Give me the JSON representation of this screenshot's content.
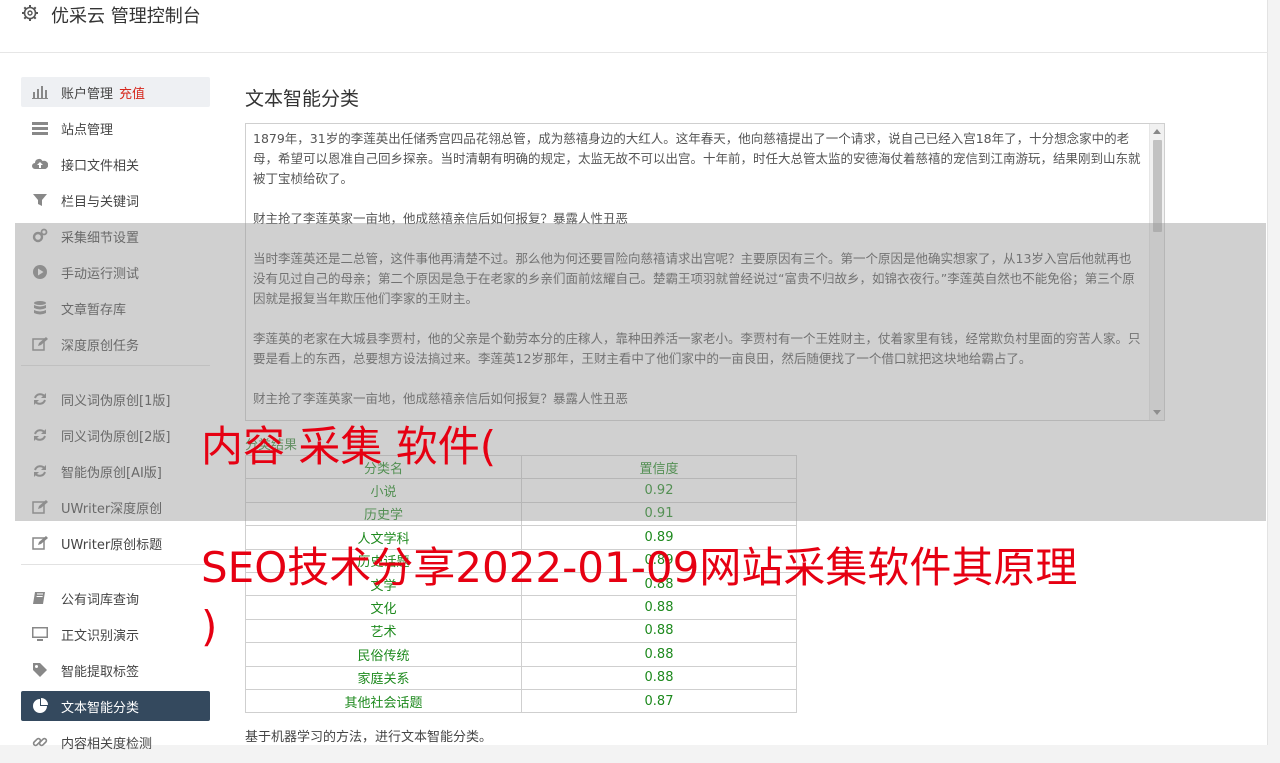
{
  "header": {
    "title": "优采云 管理控制台",
    "icon": "gear-icon"
  },
  "sidebar": {
    "items": [
      {
        "label": "账户管理",
        "badge": "充值",
        "icon": "bar-chart-icon"
      },
      {
        "label": "站点管理",
        "icon": "server-icon"
      },
      {
        "label": "接口文件相关",
        "icon": "cloud-upload-icon"
      },
      {
        "label": "栏目与关键词",
        "icon": "filter-icon"
      },
      {
        "label": "采集细节设置",
        "icon": "gears-icon"
      },
      {
        "label": "手动运行测试",
        "icon": "play-circle-icon"
      },
      {
        "label": "文章暂存库",
        "icon": "database-icon"
      },
      {
        "label": "深度原创任务",
        "icon": "edit-icon"
      },
      {
        "label": "同义词伪原创[1版]",
        "icon": "refresh-icon"
      },
      {
        "label": "同义词伪原创[2版]",
        "icon": "refresh-icon"
      },
      {
        "label": "智能伪原创[AI版]",
        "icon": "refresh-icon"
      },
      {
        "label": "UWriter深度原创",
        "icon": "edit-icon"
      },
      {
        "label": "UWriter原创标题",
        "icon": "edit-icon"
      },
      {
        "label": "公有词库查询",
        "icon": "book-icon"
      },
      {
        "label": "正文识别演示",
        "icon": "desktop-icon"
      },
      {
        "label": "智能提取标签",
        "icon": "tag-icon"
      },
      {
        "label": "文本智能分类",
        "icon": "pie-chart-icon"
      },
      {
        "label": "内容相关度检测",
        "icon": "link-icon"
      }
    ]
  },
  "main": {
    "title": "文本智能分类",
    "textarea_paragraphs": [
      "1879年，31岁的李莲英出任储秀宫四品花翎总管，成为慈禧身边的大红人。这年春天，他向慈禧提出了一个请求，说自己已经入宫18年了，十分想念家中的老母，希望可以恩准自己回乡探亲。当时清朝有明确的规定，太监无故不可以出宫。十年前，时任大总管太监的安德海仗着慈禧的宠信到江南游玩，结果刚到山东就被丁宝桢给砍了。",
      "财主抢了李莲英家一亩地，他成慈禧亲信后如何报复？暴露人性丑恶",
      "当时李莲英还是二总管，这件事他再清楚不过。那么他为何还要冒险向慈禧请求出宫呢？主要原因有三个。第一个原因是他确实想家了，从13岁入宫后他就再也没有见过自己的母亲；第二个原因是急于在老家的乡亲们面前炫耀自己。楚霸王项羽就曾经说过“富贵不归故乡，如锦衣夜行。”李莲英自然也不能免俗；第三个原因就是报复当年欺压他们李家的王财主。",
      "李莲英的老家在大城县李贾村，他的父亲是个勤劳本分的庄稼人，靠种田养活一家老小。李贾村有一个王姓财主，仗着家里有钱，经常欺负村里面的穷苦人家。只要是看上的东西，总要想方设法搞过来。李莲英12岁那年，王财主看中了他们家中的一亩良田，然后随便找了一个借口就把这块地给霸占了。",
      "财主抢了李莲英家一亩地，他成慈禧亲信后如何报复？暴露人性丑恶"
    ],
    "results_label": "分类结果",
    "table": {
      "headers": [
        "分类名",
        "置信度"
      ],
      "rows": [
        [
          "小说",
          "0.92"
        ],
        [
          "历史学",
          "0.91"
        ],
        [
          "人文学科",
          "0.89"
        ],
        [
          "历史话题",
          "0.89"
        ],
        [
          "文学",
          "0.88"
        ],
        [
          "文化",
          "0.88"
        ],
        [
          "艺术",
          "0.88"
        ],
        [
          "民俗传统",
          "0.88"
        ],
        [
          "家庭关系",
          "0.88"
        ],
        [
          "其他社会话题",
          "0.87"
        ]
      ]
    },
    "footer_note": "基于机器学习的方法，进行文本智能分类。"
  },
  "watermark": {
    "line1": "内容 采集 软件(",
    "line2": "SEO技术分享2022-01-09网站采集软件其原理",
    "line3": ")"
  },
  "colors": {
    "accent": "#34495e",
    "watermark": "#e60012",
    "result_text": "#1e8a1e",
    "badge": "#d6271c"
  }
}
